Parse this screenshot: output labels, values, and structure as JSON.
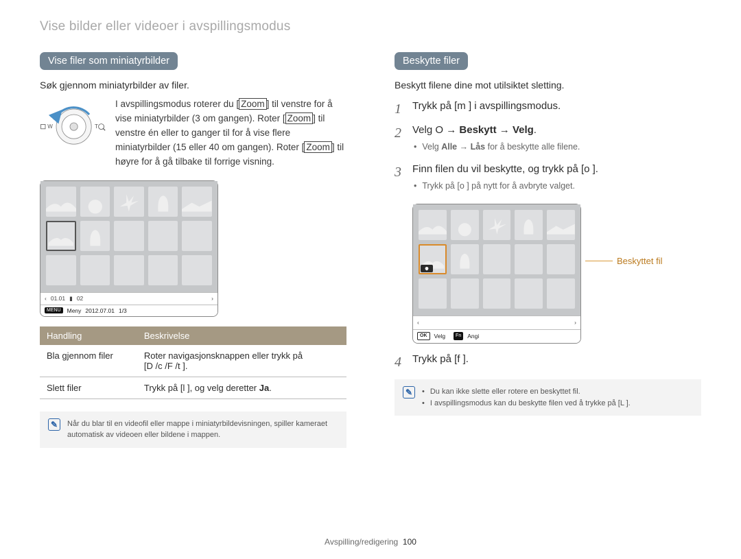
{
  "header": {
    "breadcrumb": "Vise bilder eller videoer i avspillingsmodus"
  },
  "left": {
    "pill": "Vise filer som miniatyrbilder",
    "intro": "Søk gjennom miniatyrbilder av filer.",
    "dial_markers": {
      "w": "W",
      "t": "T"
    },
    "dial_paragraph": {
      "p1a": "I avspillingsmodus roterer du [",
      "zoom1": "Zoom",
      "p1b": "] til venstre for å vise miniatyrbilder (3 om gangen). Roter [",
      "zoom2": "Zoom",
      "p1c": "] til venstre én eller to ganger til for å vise flere miniatyrbilder (15 eller 40 om gangen). Roter [",
      "zoom3": "Zoom",
      "p1d": "] til høyre for å gå tilbake til forrige visning."
    },
    "statusbar": {
      "left_icon_label": "01.01",
      "mid_label": "02",
      "menu_btn": "MENU",
      "menu_label": "Meny",
      "date": "2012.07.01",
      "page": "1/3"
    },
    "table": {
      "h1": "Handling",
      "h2": "Beskrivelse",
      "r1c1": "Bla gjennom filer",
      "r1c2_a": "Roter navigasjonsknappen eller trykk på",
      "r1c2_b": "[D    /c  /F /t      ].",
      "r2c1": "Slett filer",
      "r2c2_a": "Trykk på [l    ], og velg deretter ",
      "r2c2_ja": "Ja",
      "r2c2_dot": "."
    },
    "note": "Når du blar til en videofil eller mappe i miniatyrbildevisningen, spiller kameraet automatisk av videoen eller bildene i mappen."
  },
  "right": {
    "pill": "Beskytte filer",
    "intro": "Beskytt filene dine mot utilsiktet sletting.",
    "step1_a": "Trykk på [",
    "step1_key": "m",
    "step1_b": "     ] i avspillingsmodus.",
    "step2_a": "Velg ",
    "step2_O": "O",
    "step2_b": "     → ",
    "step2_bold1": "Beskytt",
    "step2_c": " → ",
    "step2_bold2": "Velg",
    "step2_d": ".",
    "sub2_a": "Velg ",
    "sub2_b": "Alle",
    "sub2_c": " → ",
    "sub2_d": "Lås",
    "sub2_e": " for å beskytte alle filene.",
    "step3_a": "Finn filen du vil beskytte, og trykk på [",
    "step3_key": "o",
    "step3_b": "    ].",
    "sub3_a": "Trykk på [",
    "sub3_key": "o",
    "sub3_b": "    ] på nytt for å avbryte valget.",
    "protected_label": "Beskyttet fil",
    "statusbar": {
      "ok": "OK",
      "ok_label": "Velg",
      "fn": "Fn",
      "fn_label": "Angi"
    },
    "step4_a": "Trykk på [",
    "step4_key": "f",
    "step4_b": "    ].",
    "note_line1": "Du kan ikke slette eller rotere en beskyttet fil.",
    "note_line2_a": "I avspillingsmodus kan du beskytte filen ved å trykke på [",
    "note_line2_key": "L",
    "note_line2_b": "      ]."
  },
  "footer": {
    "section": "Avspilling/redigering",
    "page": "100"
  }
}
